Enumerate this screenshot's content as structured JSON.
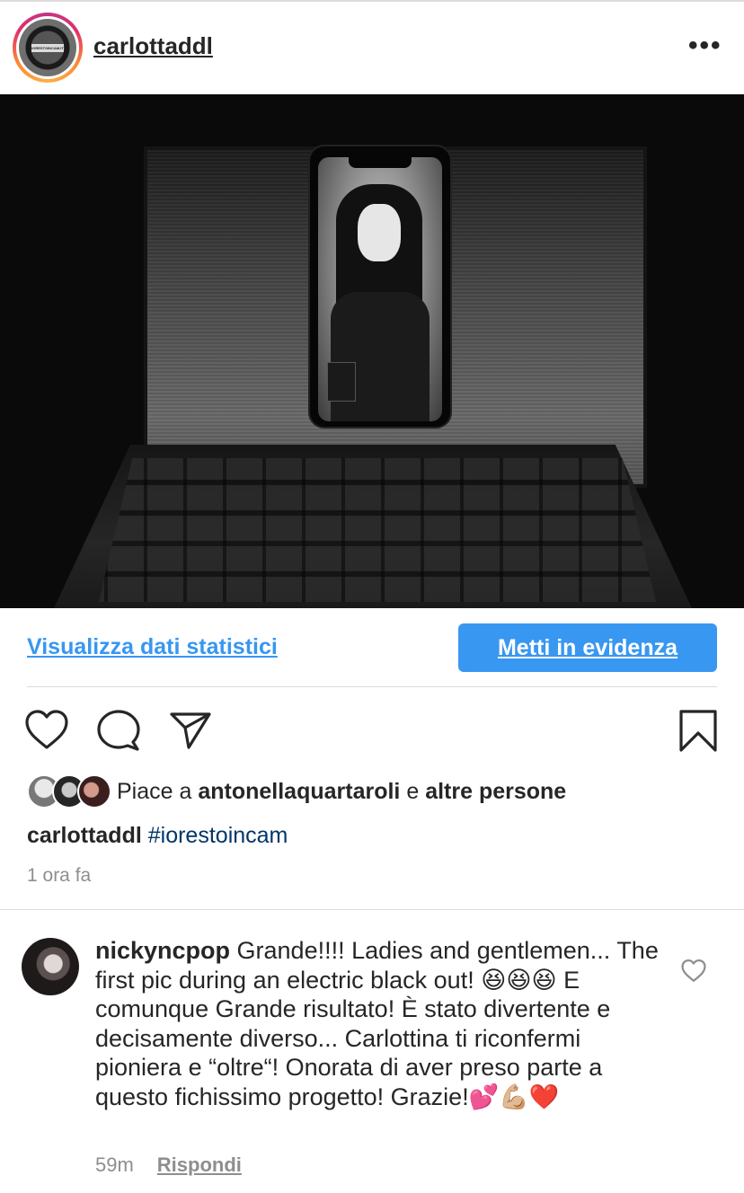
{
  "post": {
    "username": "carlottaddl",
    "avatar_badge": "IORESTOINCAM.IT",
    "more_glyph": "•••"
  },
  "actions": {
    "stats_link": "Visualizza dati statistici",
    "promote_button": "Metti in evidenza",
    "icons": [
      "heart-icon",
      "comment-icon",
      "share-icon",
      "bookmark-icon"
    ]
  },
  "likes": {
    "prefix": "Piace a ",
    "user": "antonellaquartaroli",
    "middle": " e ",
    "others": "altre persone"
  },
  "caption": {
    "user": "carlottaddl",
    "hashtag": "#iorestoincam"
  },
  "time": "1 ora fa",
  "comment": {
    "user": "nickyncpop",
    "text": " Grande!!!! Ladies and gentlemen... The first pic during an electric black out! 😆😆😆 E comunque Grande risultato! È stato divertente e decisamente diverso... Carlottina ti riconfermi pioniera e “oltre“! Onorata di aver preso parte a questo fichissimo progetto! Grazie!💕💪🏼❤️",
    "age": "59m",
    "reply": "Rispondi"
  },
  "colors": {
    "accent": "#3897f0",
    "hashtag": "#003569",
    "muted": "#8e8e8e",
    "text": "#262626"
  }
}
